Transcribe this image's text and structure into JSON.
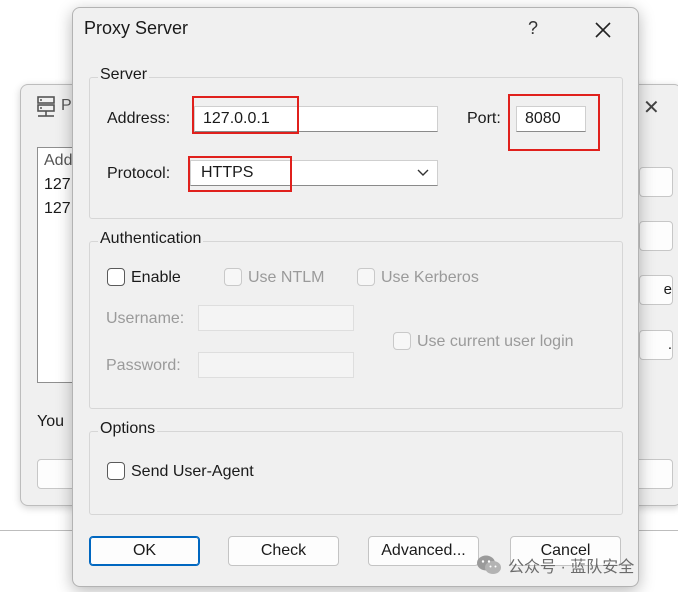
{
  "background_window": {
    "title_fragment": "P",
    "close_glyph": "✕",
    "list_items": [
      "Add",
      "127",
      "127"
    ],
    "note_fragment": "You",
    "side_button_fragments": [
      "",
      "",
      "e",
      "."
    ]
  },
  "dialog": {
    "title": "Proxy Server",
    "help_glyph": "?",
    "server": {
      "group_label": "Server",
      "address_label": "Address:",
      "address_value": "127.0.0.1",
      "port_label": "Port:",
      "port_value": "8080",
      "protocol_label": "Protocol:",
      "protocol_value": "HTTPS"
    },
    "authentication": {
      "group_label": "Authentication",
      "enable_label": "Enable",
      "use_ntlm_label": "Use NTLM",
      "use_kerberos_label": "Use Kerberos",
      "username_label": "Username:",
      "password_label": "Password:",
      "use_current_user_label": "Use current user login"
    },
    "options": {
      "group_label": "Options",
      "send_user_agent_label": "Send User-Agent"
    },
    "buttons": {
      "ok": "OK",
      "check": "Check",
      "advanced": "Advanced...",
      "cancel": "Cancel"
    }
  },
  "watermark": {
    "text": "公众号 · 蓝队安全"
  },
  "colors": {
    "highlight": "#e0201c",
    "primary_border": "#0067c0"
  }
}
